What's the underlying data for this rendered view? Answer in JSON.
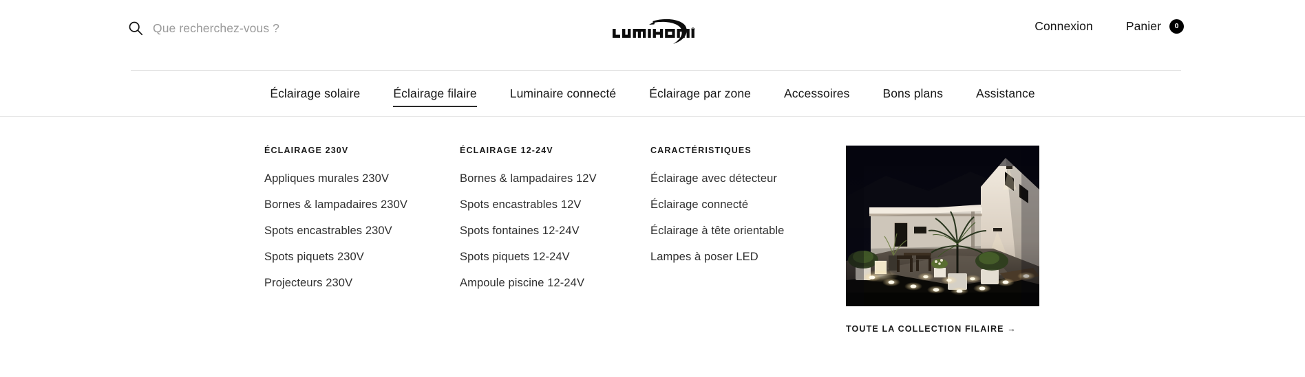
{
  "header": {
    "search": {
      "placeholder": "Que recherchez-vous ?",
      "value": "",
      "icon": "search-icon"
    },
    "logo": {
      "wordmark": "LUMIHOME",
      "trademark": "®"
    },
    "account_label": "Connexion",
    "cart_label": "Panier",
    "cart_count": "0"
  },
  "nav": {
    "items": [
      {
        "label": "Éclairage solaire",
        "active": false
      },
      {
        "label": "Éclairage filaire",
        "active": true
      },
      {
        "label": "Luminaire connecté",
        "active": false
      },
      {
        "label": "Éclairage par zone",
        "active": false
      },
      {
        "label": "Accessoires",
        "active": false
      },
      {
        "label": "Bons plans",
        "active": false
      },
      {
        "label": "Assistance",
        "active": false
      }
    ]
  },
  "megamenu": {
    "columns": [
      {
        "title": "ÉCLAIRAGE 230V",
        "links": [
          "Appliques murales 230V",
          "Bornes & lampadaires 230V",
          "Spots encastrables 230V",
          "Spots piquets 230V",
          "Projecteurs 230V"
        ]
      },
      {
        "title": "ÉCLAIRAGE 12-24V",
        "links": [
          "Bornes & lampadaires 12V",
          "Spots encastrables 12V",
          "Spots fontaines 12-24V",
          "Spots piquets 12-24V",
          "Ampoule piscine 12-24V"
        ]
      },
      {
        "title": "CARACTÉRISTIQUES",
        "links": [
          "Éclairage avec détecteur",
          "Éclairage connecté",
          "Éclairage à tête orientable",
          "Lampes à poser LED"
        ]
      }
    ],
    "promo": {
      "image_alt": "Terrasse de maison éclairée la nuit par des spots encastrés",
      "cta_label": "TOUTE LA COLLECTION FILAIRE →"
    }
  },
  "colors": {
    "text": "#161616",
    "muted": "#9a9a9a",
    "rule": "#e6e6e6",
    "badge_bg": "#000000",
    "badge_fg": "#ffffff",
    "page_bg": "#ffffff"
  }
}
